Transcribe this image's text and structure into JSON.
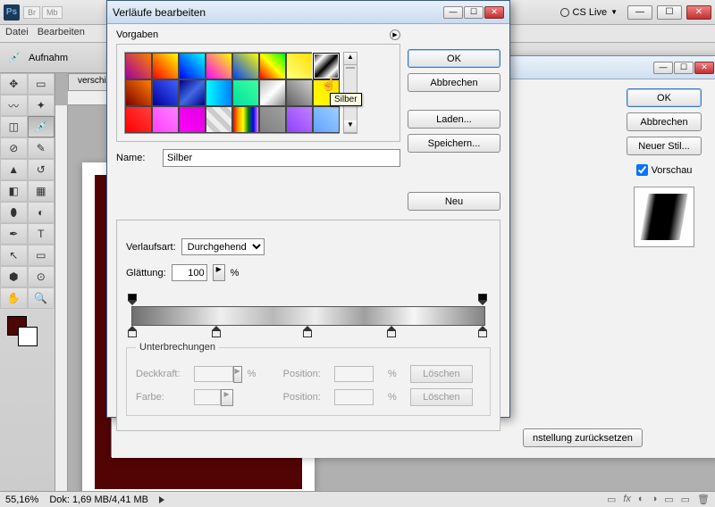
{
  "app": {
    "icon_text": "Ps",
    "ext1": "Br",
    "ext2": "Mb",
    "cs_live": "CS Live",
    "title_btns": {
      "min": "—",
      "max": "☐",
      "close": "✕"
    }
  },
  "menubar": [
    "Datei",
    "Bearbeiten"
  ],
  "options": {
    "label": "Aufnahm"
  },
  "doc": {
    "tab": "verschi"
  },
  "statusbar": {
    "zoom": "55,16%",
    "doc_label": "Dok:",
    "doc_size": "1,69 MB/4,41 MB"
  },
  "layer_style": {
    "buttons": {
      "ok": "OK",
      "cancel": "Abbrechen",
      "new_style": "Neuer Stil..."
    },
    "preview_label": "Vorschau",
    "reset": "nstellung zurücksetzen"
  },
  "gradient_editor": {
    "title": "Verläufe bearbeiten",
    "presets_label": "Vorgaben",
    "tooltip": "Silber",
    "buttons": {
      "ok": "OK",
      "cancel": "Abbrechen",
      "load": "Laden...",
      "save": "Speichern...",
      "new": "Neu"
    },
    "name_label": "Name:",
    "name_value": "Silber",
    "type_label": "Verlaufsart:",
    "type_value": "Durchgehend",
    "smooth_label": "Glättung:",
    "smooth_value": "100",
    "pct": "%",
    "stops": {
      "legend": "Unterbrechungen",
      "opacity_label": "Deckkraft:",
      "color_label": "Farbe:",
      "position_label": "Position:",
      "delete": "Löschen"
    }
  },
  "preset_gradients": [
    "linear-gradient(45deg,#a000a0,#ff8000)",
    "linear-gradient(45deg,#ff0000,#ffff00)",
    "linear-gradient(45deg,#0000ff,#00ffff)",
    "linear-gradient(45deg,#ff00ff,#ffff00)",
    "linear-gradient(45deg,#0040ff,#ffff00)",
    "linear-gradient(45deg,#ff0000,#ffff00,#00ff00)",
    "linear-gradient(45deg,#ffff80,#ffe000)",
    "linear-gradient(135deg,#000,#fff,#000,#fff,#000)",
    "linear-gradient(45deg,#800000,#ff8000)",
    "linear-gradient(45deg,#0000a0,#4060ff)",
    "linear-gradient(135deg,#00008b,#4169e1,#00008b)",
    "linear-gradient(90deg,#00ffff,#0080ff)",
    "linear-gradient(45deg,#00e0a0,#40ffa0)",
    "linear-gradient(135deg,#c0c0c0,#fff,#888)",
    "linear-gradient(45deg,#606060,#d0d0d0)",
    "linear-gradient(45deg,#ffff00,#ffe000)",
    "linear-gradient(45deg,#ff0000,#ff4040)",
    "linear-gradient(45deg,#ff40ff,#ff80ff)",
    "linear-gradient(45deg,#ff00ff,#e000e0)",
    "repeating-linear-gradient(45deg,#eee 0 6px,#ccc 6px 12px)",
    "linear-gradient(90deg,red,orange,yellow,green,blue,violet)",
    "linear-gradient(45deg,#808080,#a0a0a0)",
    "linear-gradient(45deg,#9040ff,#c080ff)",
    "linear-gradient(45deg,#60a0ff,#a0d0ff)"
  ],
  "preset_selected_index": 7,
  "color_stops_bottom_pct": [
    0,
    24,
    50,
    74,
    100
  ],
  "opacity_stops_top_pct": [
    0,
    100
  ]
}
